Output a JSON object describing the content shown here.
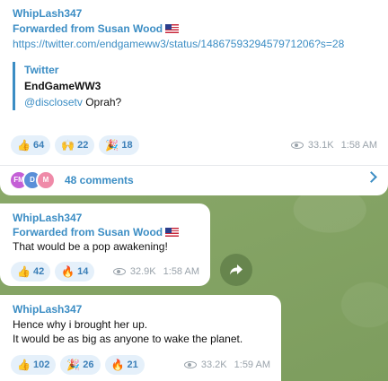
{
  "msg1": {
    "sender": "WhipLash347",
    "forwarded": "Forwarded from Susan Wood",
    "link": "https://twitter.com/endgameww3/status/1486759329457971206?s=28",
    "preview": {
      "site": "Twitter",
      "title": "EndGameWW3",
      "mention": "@disclosetv",
      "text": " Oprah?"
    },
    "reactions": [
      {
        "icon": "thumbs-up",
        "emoji": "👍",
        "count": "64"
      },
      {
        "icon": "hands",
        "emoji": "🙌",
        "count": "22"
      },
      {
        "icon": "party-popper",
        "emoji": "🎉",
        "count": "18"
      }
    ],
    "views": "33.1K",
    "time": "1:58 AM",
    "comments": {
      "label": "48 comments",
      "avatars": [
        {
          "initials": "FM",
          "color": "#c45fd6"
        },
        {
          "initials": "D",
          "color": "#5a8fd8"
        },
        {
          "initials": "M",
          "color": "#ef8aa8"
        }
      ]
    }
  },
  "msg2": {
    "sender": "WhipLash347",
    "forwarded": "Forwarded from Susan Wood",
    "text": "That would be a pop awakening!",
    "reactions": [
      {
        "icon": "thumbs-up",
        "emoji": "👍",
        "count": "42"
      },
      {
        "icon": "fire",
        "emoji": "🔥",
        "count": "14"
      }
    ],
    "views": "32.9K",
    "time": "1:58 AM"
  },
  "msg3": {
    "sender": "WhipLash347",
    "line1": "Hence why i brought her up.",
    "line2": "It would be as big as anyone to wake the planet.",
    "reactions": [
      {
        "icon": "thumbs-up",
        "emoji": "👍",
        "count": "102"
      },
      {
        "icon": "party-popper",
        "emoji": "🎉",
        "count": "26"
      },
      {
        "icon": "fire",
        "emoji": "🔥",
        "count": "21"
      }
    ],
    "views": "33.2K",
    "time": "1:59 AM"
  }
}
